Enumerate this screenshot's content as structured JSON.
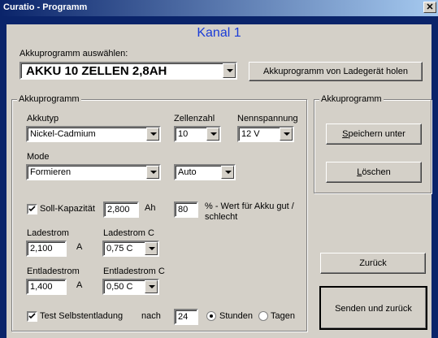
{
  "window": {
    "title": "Curatio - Programm",
    "close_glyph": "✕"
  },
  "channel_title": "Kanal 1",
  "program_select": {
    "label": "Akkuprogramm  auswählen:",
    "value": "AKKU 10 ZELLEN 2,8AH",
    "fetch_button": "Akkuprogramm von Ladegerät holen"
  },
  "program_group": {
    "legend": "Akkuprogramm",
    "akkutyp_label": "Akkutyp",
    "akkutyp_value": "Nickel-Cadmium",
    "zellenzahl_label": "Zellenzahl",
    "zellenzahl_value": "10",
    "nennspannung_label": "Nennspannung",
    "nennspannung_value": "12 V",
    "mode_label": "Mode",
    "mode_value": "Formieren",
    "auto_value": "Auto",
    "soll_checkbox_label": "Soll-Kapazität",
    "soll_checked": true,
    "soll_value": "2,800",
    "soll_unit": "Ah",
    "percent_value": "80",
    "percent_label_1": "% - Wert für  Akku  gut /",
    "percent_label_2": "schlecht",
    "ladestrom_label": "Ladestrom",
    "ladestrom_value": "2,100",
    "ladestrom_unit": "A",
    "ladestrom_c_label": "Ladestrom C",
    "ladestrom_c_value": "0,75 C",
    "entladestrom_label": "Entladestrom",
    "entladestrom_value": "1,400",
    "entladestrom_unit": "A",
    "entladestrom_c_label": "Entladestrom C",
    "entladestrom_c_value": "0,50 C",
    "test_checkbox_label": "Test Selbstentladung",
    "test_checked": true,
    "nach_label": "nach",
    "nach_value": "24",
    "radio_stunden": "Stunden",
    "radio_tagen": "Tagen",
    "selected_unit": "Stunden"
  },
  "side_group": {
    "legend": "Akkuprogramm",
    "save_button_pre": "",
    "save_button_accel": "S",
    "save_button_post": "peichern unter",
    "delete_button_accel": "L",
    "delete_button_post": "öschen"
  },
  "back_button": "Zurück",
  "send_button": "Senden und zurück"
}
